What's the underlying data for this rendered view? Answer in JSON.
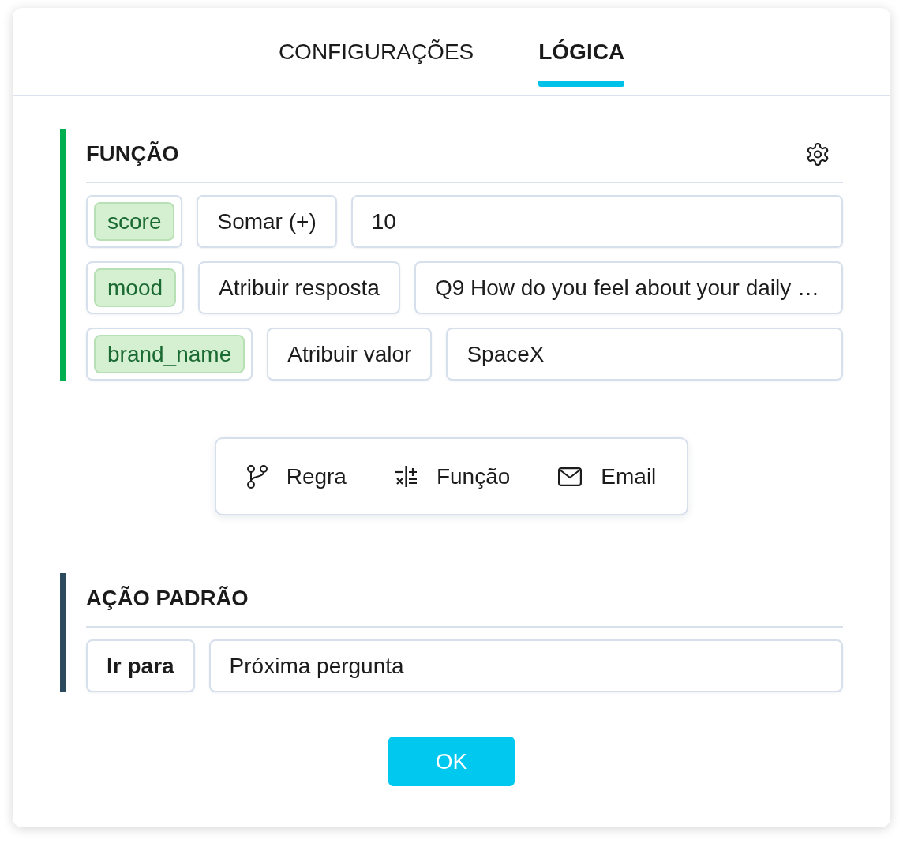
{
  "tabs": [
    {
      "label": "CONFIGURAÇÕES",
      "selected": false
    },
    {
      "label": "LÓGICA",
      "selected": true
    }
  ],
  "function_section": {
    "title": "FUNÇÃO",
    "rows": [
      {
        "variable": "score",
        "operation": "Somar (+)",
        "value": "10"
      },
      {
        "variable": "mood",
        "operation": "Atribuir resposta",
        "value": "Q9 How do you feel about your daily …"
      },
      {
        "variable": "brand_name",
        "operation": "Atribuir valor",
        "value": "SpaceX"
      }
    ]
  },
  "add_menu": [
    {
      "kind": "rule",
      "label": "Regra"
    },
    {
      "kind": "function",
      "label": "Função"
    },
    {
      "kind": "email",
      "label": "Email"
    }
  ],
  "default_action_section": {
    "title": "AÇÃO PADRÃO",
    "action": "Ir para",
    "target": "Próxima pergunta"
  },
  "ok_button": "OK"
}
